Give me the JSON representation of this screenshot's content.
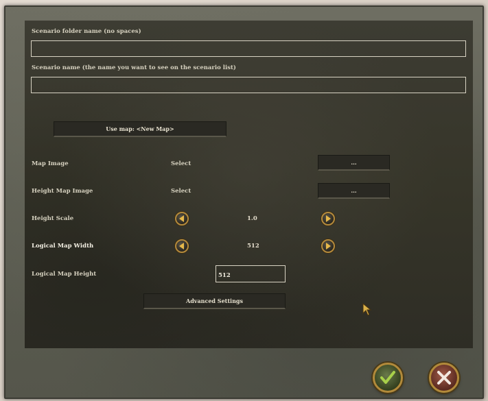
{
  "form": {
    "folder_label": "Scenario folder name (no spaces)",
    "folder_value": "",
    "name_label": "Scenario name (the name you want to see on the scenario list)",
    "name_value": "",
    "use_map_label": "Use map: <New Map>"
  },
  "rows": {
    "map_image": {
      "label": "Map Image",
      "status": "Select",
      "button": "..."
    },
    "height_map_image": {
      "label": "Height Map Image",
      "status": "Select",
      "button": "..."
    },
    "height_scale": {
      "label": "Height Scale",
      "value": "1.0"
    },
    "logical_width": {
      "label": "Logical Map Width",
      "value": "512"
    },
    "logical_height": {
      "label": "Logical Map Height",
      "value": "512"
    }
  },
  "advanced_label": "Advanced Settings",
  "icons": {
    "decrement": "left-arrow-icon",
    "increment": "right-arrow-icon",
    "confirm": "checkmark-icon",
    "cancel": "x-icon",
    "pointer": "mouse-cursor-icon"
  },
  "colors": {
    "panel": "#363529",
    "frame": "#5c5d52",
    "gold_border": "#b48a3c",
    "text": "#d7d2c0"
  }
}
